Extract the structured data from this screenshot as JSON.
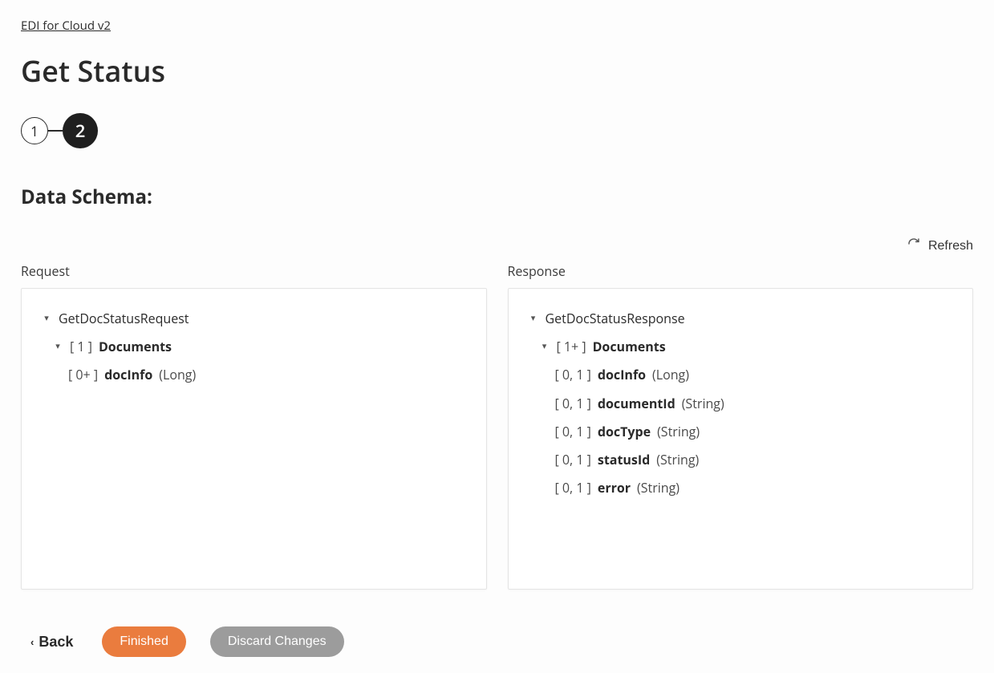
{
  "breadcrumb": "EDI for Cloud v2",
  "title": "Get Status",
  "stepper": {
    "step1": "1",
    "step2": "2"
  },
  "section_title": "Data Schema:",
  "toolbar": {
    "refresh": "Refresh"
  },
  "columns": {
    "request": {
      "header": "Request",
      "root": "GetDocStatusRequest",
      "rows": [
        {
          "card": "[ 1 ]",
          "name": "Documents",
          "type": "",
          "expandable": true
        },
        {
          "card": "[ 0+ ]",
          "name": "docInfo",
          "type": "(Long)",
          "expandable": false
        }
      ]
    },
    "response": {
      "header": "Response",
      "root": "GetDocStatusResponse",
      "rows": [
        {
          "card": "[ 1+ ]",
          "name": "Documents",
          "type": "",
          "expandable": true
        },
        {
          "card": "[ 0, 1 ]",
          "name": "docInfo",
          "type": "(Long)",
          "expandable": false
        },
        {
          "card": "[ 0, 1 ]",
          "name": "documentId",
          "type": "(String)",
          "expandable": false
        },
        {
          "card": "[ 0, 1 ]",
          "name": "docType",
          "type": "(String)",
          "expandable": false
        },
        {
          "card": "[ 0, 1 ]",
          "name": "statusId",
          "type": "(String)",
          "expandable": false
        },
        {
          "card": "[ 0, 1 ]",
          "name": "error",
          "type": "(String)",
          "expandable": false
        }
      ]
    }
  },
  "footer": {
    "back": "Back",
    "finished": "Finished",
    "discard": "Discard Changes"
  }
}
